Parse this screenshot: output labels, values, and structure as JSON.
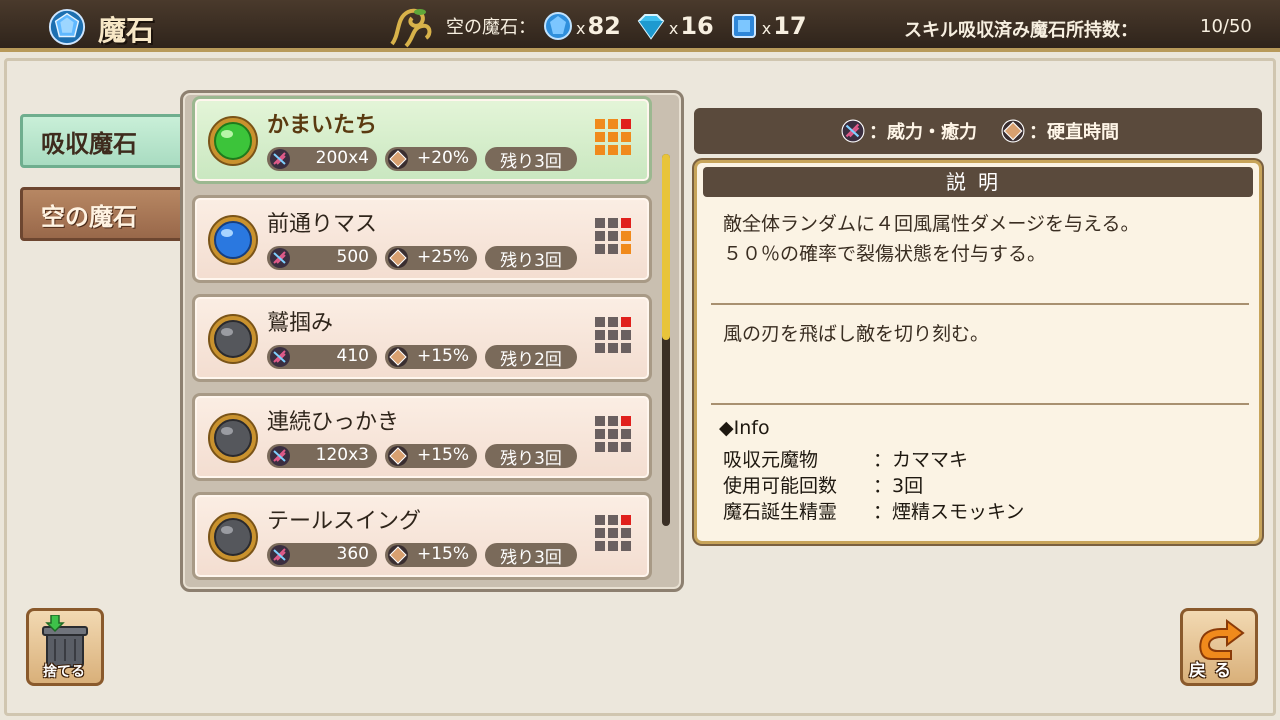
{
  "header": {
    "title": "魔石",
    "empty_stone_label": "空の魔石：",
    "stone_counts": [
      {
        "icon": "blue-round-gem-icon",
        "x": "x",
        "count": "82"
      },
      {
        "icon": "cyan-diamond-gem-icon",
        "x": "x",
        "count": "16"
      },
      {
        "icon": "blue-square-gem-icon",
        "x": "x",
        "count": "17"
      }
    ],
    "absorbed_label": "スキル吸収済み魔石所持数：",
    "absorbed_value": "10/50"
  },
  "tabs": {
    "absorbed": "吸収魔石",
    "empty": "空の魔石"
  },
  "items": [
    {
      "name": "かまいたち",
      "power": "200x4",
      "stun": "+20%",
      "remaining": "残り3回",
      "orb": "green",
      "selected": true
    },
    {
      "name": "前通りマス",
      "power": "500",
      "stun": "+25%",
      "remaining": "残り3回",
      "orb": "blue",
      "selected": false
    },
    {
      "name": "鷲掴み",
      "power": "410",
      "stun": "+15%",
      "remaining": "残り2回",
      "orb": "gray",
      "selected": false
    },
    {
      "name": "連続ひっかき",
      "power": "120x3",
      "stun": "+15%",
      "remaining": "残り3回",
      "orb": "gray",
      "selected": false
    },
    {
      "name": "テールスイング",
      "power": "360",
      "stun": "+15%",
      "remaining": "残り3回",
      "orb": "gray",
      "selected": false
    }
  ],
  "scroll": {
    "position": 0,
    "visible_fraction": 0.5
  },
  "legend": {
    "power_label": "：威力・癒力",
    "stun_label": "：硬直時間"
  },
  "description": {
    "heading": "説明",
    "effect_line1": "敵全体ランダムに４回風属性ダメージを与える。",
    "effect_line2": "５０％の確率で裂傷状態を付与する。",
    "flavor": "風の刃を飛ばし敵を切り刻む。",
    "info_title": "◆Info",
    "info_rows": [
      {
        "key": "吸収元魔物",
        "value": "：カママキ"
      },
      {
        "key": "使用可能回数",
        "value": "：3回"
      },
      {
        "key": "魔石誕生精霊",
        "value": "：煙精スモッキン"
      }
    ]
  },
  "buttons": {
    "discard": "捨てる",
    "back": "戻る"
  },
  "colors": {
    "accent_gold": "#b89a5a",
    "header_bg": "#3a2c20",
    "selected_item": "#c9e7c0",
    "tab_active": "#a9dcc1",
    "tab_inactive": "#99684a"
  }
}
